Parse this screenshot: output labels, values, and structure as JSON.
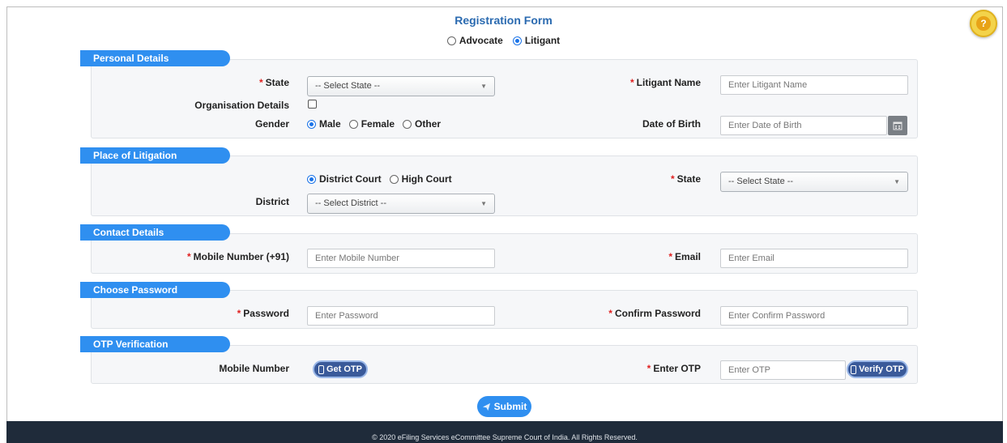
{
  "form": {
    "title": "Registration Form",
    "user_types": [
      "Advocate",
      "Litigant"
    ],
    "user_type_selected": "Litigant"
  },
  "sections": {
    "personal": {
      "title": "Personal Details",
      "state_label": "State",
      "state_value": "-- Select State --",
      "org_label": "Organisation Details",
      "gender_label": "Gender",
      "gender_options": [
        "Male",
        "Female",
        "Other"
      ],
      "gender_selected": "Male",
      "name_label": "Litigant Name",
      "name_placeholder": "Enter Litigant Name",
      "dob_label": "Date of Birth",
      "dob_placeholder": "Enter Date of Birth"
    },
    "place": {
      "title": "Place of Litigation",
      "court_options": [
        "District Court",
        "High Court"
      ],
      "court_selected": "District Court",
      "district_label": "District",
      "district_value": "-- Select District --",
      "state_label": "State",
      "state_value": "-- Select State --"
    },
    "contact": {
      "title": "Contact Details",
      "mobile_label": "Mobile Number (+91)",
      "mobile_placeholder": "Enter Mobile Number",
      "email_label": "Email",
      "email_placeholder": "Enter Email"
    },
    "password": {
      "title": "Choose Password",
      "password_label": "Password",
      "password_placeholder": "Enter Password",
      "confirm_label": "Confirm Password",
      "confirm_placeholder": "Enter Confirm Password"
    },
    "otp": {
      "title": "OTP Verification",
      "mobile_label": "Mobile Number",
      "get_otp_label": "Get OTP",
      "enter_otp_label": "Enter OTP",
      "otp_placeholder": "Enter OTP",
      "verify_label": "Verify OTP"
    }
  },
  "required_marker": "*",
  "submit_label": "Submit",
  "footer_text": "© 2020 eFiling Services eCommittee Supreme Court of India. All Rights Reserved.",
  "colors": {
    "accent": "#2f8ff0",
    "title": "#2a6ab0",
    "required": "#e02020",
    "footer_bg": "#1f2b3a",
    "otp_button": "#3a5a9a"
  },
  "icons": {
    "help": "help-icon",
    "calendar": "calendar-icon",
    "phone": "phone-icon",
    "send": "send-icon"
  }
}
